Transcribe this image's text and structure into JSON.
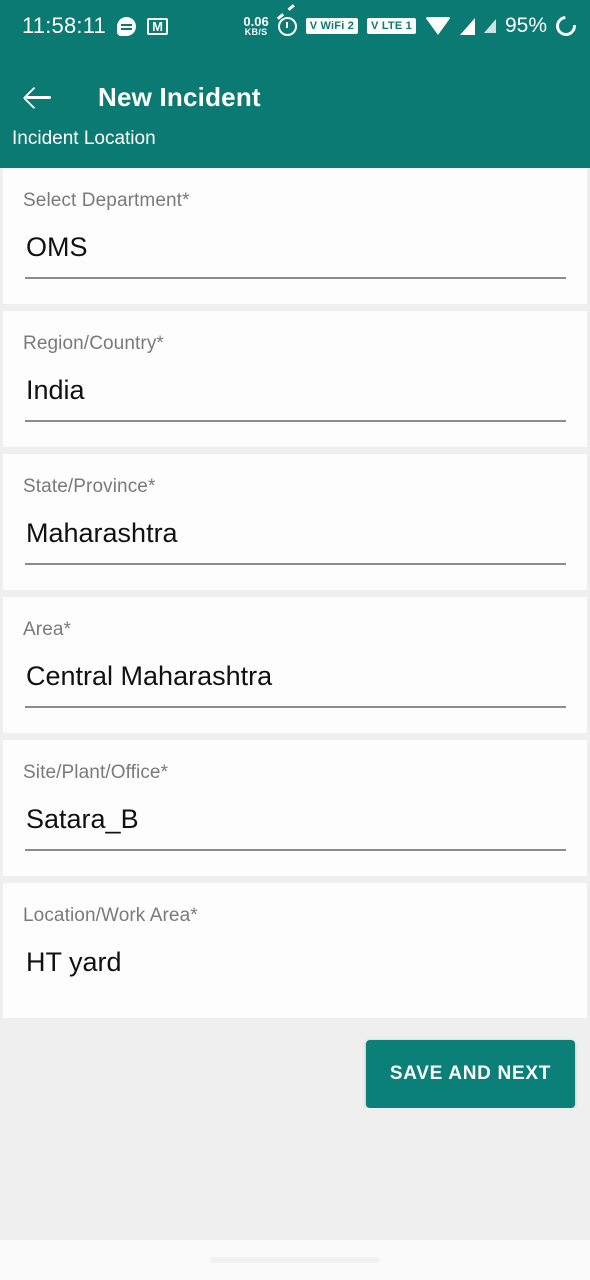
{
  "status_bar": {
    "clock": "11:58:11",
    "messages_icon": "message-bubble-icon",
    "mail_icon": "gmail-icon",
    "net_speed_value": "0.06",
    "net_speed_unit": "KB/S",
    "alarm_icon": "alarm-clock-icon",
    "vowifi_badge": "V WiFi 2",
    "volte_badge": "V LTE 1",
    "wifi_icon": "wifi-icon",
    "signal_icon_1": "cellular-signal-icon",
    "signal_icon_2": "cellular-signal-icon",
    "battery_percent": "95%",
    "battery_icon": "battery-circle-icon"
  },
  "app_bar": {
    "back_icon": "back-arrow-icon",
    "title": "New Incident",
    "subtitle": "Incident Location"
  },
  "form": {
    "fields": [
      {
        "label": "Select Department*",
        "value": "OMS",
        "has_rule": true
      },
      {
        "label": "Region/Country*",
        "value": "India",
        "has_rule": true
      },
      {
        "label": "State/Province*",
        "value": "Maharashtra",
        "has_rule": true
      },
      {
        "label": "Area*",
        "value": "Central Maharashtra",
        "has_rule": true
      },
      {
        "label": "Site/Plant/Office*",
        "value": "Satara_B",
        "has_rule": true
      },
      {
        "label": "Location/Work Area*",
        "value": "HT yard",
        "has_rule": false
      }
    ]
  },
  "actions": {
    "save_and_next_label": "SAVE AND NEXT"
  },
  "colors": {
    "primary_teal": "#0b7a72",
    "button_teal": "#0b8079",
    "page_background": "#efefef",
    "card_background": "#fdfdfd",
    "label_gray": "#7a7a7a",
    "value_black": "#111111",
    "rule_gray": "#8c8c8c"
  }
}
